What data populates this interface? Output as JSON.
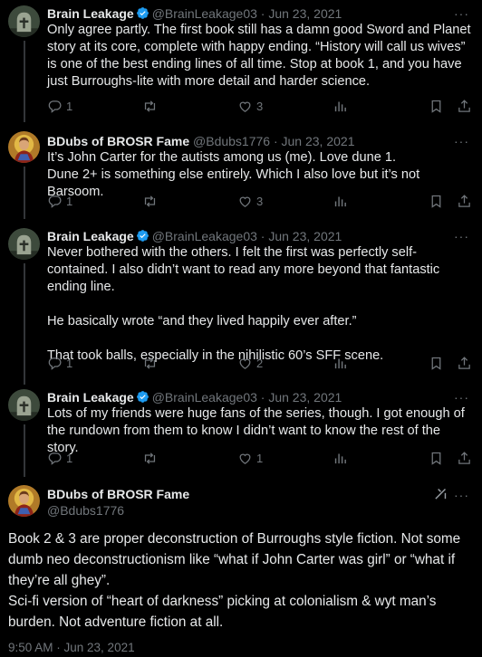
{
  "tweets": [
    {
      "name": "Brain Leakage",
      "handle": "@BrainLeakage03",
      "date": "· Jun 23, 2021",
      "verified": true,
      "text": "Only agree partly. The first book still has a damn good Sword and Planet story at its core, complete with happy ending. “History will call us wives” is one of the best ending lines of all time. Stop at book 1, and you have just Burroughs-lite with more detail and harder science.",
      "replies": "1",
      "retweets": "",
      "likes": "3"
    },
    {
      "name": "BDubs of BROSR Fame",
      "handle": "@Bdubs1776",
      "date": "· Jun 23, 2021",
      "verified": false,
      "text": "It’s John Carter for the autists among us (me). Love dune 1.\nDune 2+ is something else entirely. Which I also love but it’s not Barsoom.",
      "replies": "1",
      "retweets": "",
      "likes": "3"
    },
    {
      "name": "Brain Leakage",
      "handle": "@BrainLeakage03",
      "date": "· Jun 23, 2021",
      "verified": true,
      "text": "Never bothered with the others. I felt the first was perfectly self-contained. I also didn’t want to read any more beyond that fantastic ending line.\n\nHe basically wrote “and they lived happily ever after.”\n\nThat took balls, especially in the nihilistic 60’s SFF scene.",
      "replies": "1",
      "retweets": "",
      "likes": "2"
    },
    {
      "name": "Brain Leakage",
      "handle": "@BrainLeakage03",
      "date": "· Jun 23, 2021",
      "verified": true,
      "text": "Lots of my friends were huge fans of the series, though. I got enough of the rundown from them to know I didn’t want to know the rest of the story.",
      "replies": "1",
      "retweets": "",
      "likes": "1"
    }
  ],
  "main_tweet": {
    "name": "BDubs of BROSR Fame",
    "handle": "@Bdubs1776",
    "text": "Book 2 & 3 are proper deconstruction of Burroughs style fiction. Not some dumb neo deconstructionism like “what if John Carter was girl” or “what if they’re all ghey”.\nSci-fi version of “heart of darkness” picking at colonialism & wyt man’s burden. Not adventure fiction at all.",
    "timestamp": "9:50 AM · Jun 23, 2021"
  },
  "more_glyph": "···",
  "colors": {
    "background": "#000000",
    "text": "#e7e9ea",
    "muted": "#71767b",
    "verified": "#1d9bf0",
    "divider": "#2f3336"
  },
  "icons": {
    "reply": "reply-icon",
    "retweet": "retweet-icon",
    "like": "heart-icon",
    "views": "views-icon",
    "bookmark": "bookmark-icon",
    "share": "share-icon",
    "grok": "grok-icon"
  }
}
